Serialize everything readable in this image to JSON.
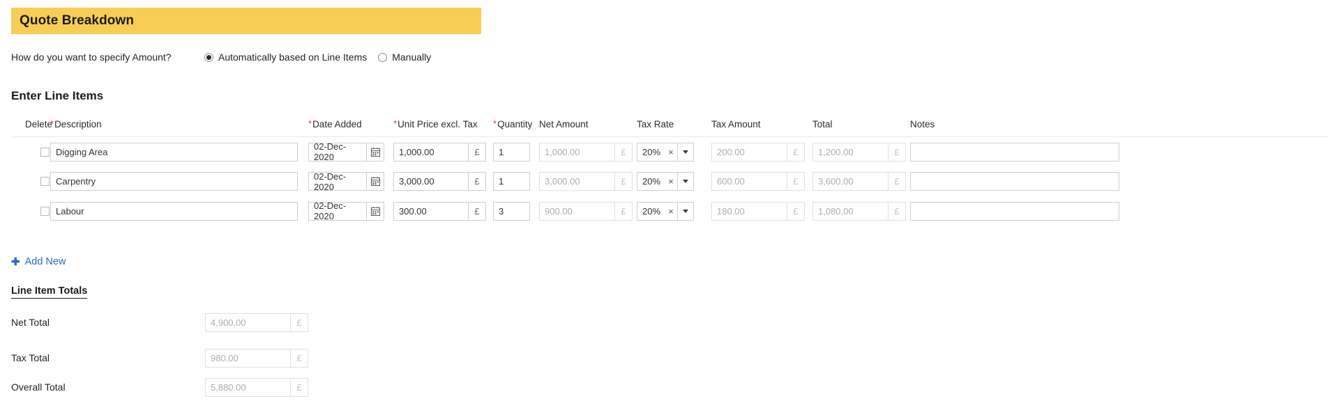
{
  "banner": {
    "title": "Quote Breakdown",
    "background_color": "#f7cd55"
  },
  "amount_spec": {
    "label": "How do you want to specify Amount?",
    "options": [
      {
        "label": "Automatically based on Line Items",
        "selected": true
      },
      {
        "label": "Manually",
        "selected": false
      }
    ]
  },
  "line_items_section": {
    "title": "Enter Line Items",
    "columns": [
      {
        "label": "Delete",
        "required": false
      },
      {
        "label": "Description",
        "required": true
      },
      {
        "label": "Date Added",
        "required": true
      },
      {
        "label": "Unit Price excl. Tax",
        "required": true
      },
      {
        "label": "Quantity",
        "required": true
      },
      {
        "label": "Net Amount",
        "required": false
      },
      {
        "label": "Tax Rate",
        "required": false
      },
      {
        "label": "Tax Amount",
        "required": false
      },
      {
        "label": "Total",
        "required": false
      },
      {
        "label": "Notes",
        "required": false
      }
    ],
    "currency_symbol": "£",
    "rows": [
      {
        "description": "Digging Area",
        "date_added": "02-Dec-2020",
        "unit_price": "1,000.00",
        "quantity": "1",
        "net_amount": "1,000.00",
        "tax_rate": "20%",
        "tax_amount": "200.00",
        "total": "1,200.00",
        "notes": ""
      },
      {
        "description": "Carpentry",
        "date_added": "02-Dec-2020",
        "unit_price": "3,000.00",
        "quantity": "1",
        "net_amount": "3,000.00",
        "tax_rate": "20%",
        "tax_amount": "600.00",
        "total": "3,600.00",
        "notes": ""
      },
      {
        "description": "Labour",
        "date_added": "02-Dec-2020",
        "unit_price": "300.00",
        "quantity": "3",
        "net_amount": "900.00",
        "tax_rate": "20%",
        "tax_amount": "180.00",
        "total": "1,080.00",
        "notes": ""
      }
    ],
    "add_new_label": "Add New",
    "add_new_icon": "plus-icon",
    "clear_icon": "×"
  },
  "totals": {
    "heading": "Line Item Totals",
    "currency_symbol": "£",
    "rows": [
      {
        "label": "Net Total",
        "value": "4,900.00"
      },
      {
        "label": "Tax Total",
        "value": "980.00"
      },
      {
        "label": "Overall Total",
        "value": "5,880.00"
      }
    ]
  }
}
